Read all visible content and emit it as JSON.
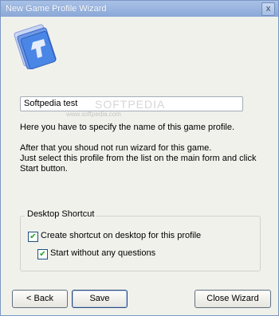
{
  "window": {
    "title": "New Game Profile Wizard",
    "close_glyph": "x"
  },
  "logo": {
    "icon": "wizard-logo-icon"
  },
  "profile_name": {
    "value": "Softpedia test"
  },
  "instructions": {
    "line1": "Here you have to specify the name of this game profile.",
    "line2": "After that you shoud not run wizard for this game.",
    "line3": "Just select this profile from the list on the main form and click",
    "line4": "Start button."
  },
  "watermark": {
    "brand": "SOFTPEDIA",
    "url": "www.softpedia.com"
  },
  "shortcut_group": {
    "label": "Desktop Shortcut",
    "create_shortcut": {
      "label": "Create shortcut on desktop for this profile",
      "checked": true
    },
    "start_without_questions": {
      "label": "Start without any questions",
      "checked": true
    }
  },
  "buttons": {
    "back": "< Back",
    "save": "Save",
    "close": "Close Wizard"
  },
  "colors": {
    "titlebar": "#8aa8d8",
    "accent_check": "#21a121"
  }
}
